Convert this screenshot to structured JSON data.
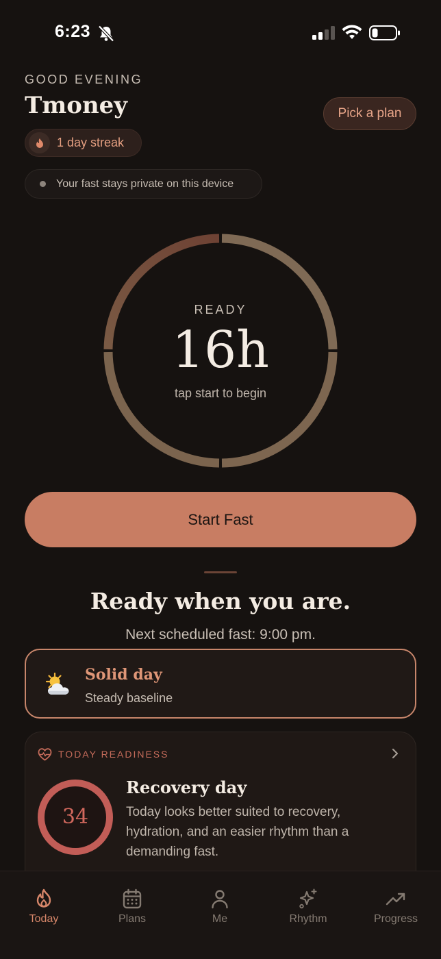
{
  "status_bar": {
    "time": "6:23",
    "icons": [
      "bell-slash-icon",
      "signal-icon",
      "wifi-icon",
      "battery-icon"
    ]
  },
  "header": {
    "greeting": "GOOD EVENING",
    "user_name": "Tmoney",
    "plan_button": "Pick a plan",
    "streak": "1 day streak",
    "privacy": "Your fast stays private on this device"
  },
  "timer": {
    "status": "READY",
    "duration": "16h",
    "hint": "tap start to begin"
  },
  "start_button": "Start Fast",
  "ready_section": {
    "heading": "Ready when you are.",
    "next_fast": "Next scheduled fast: 9:00 pm."
  },
  "day_card": {
    "icon": "sun-behind-cloud-icon",
    "title": "Solid day",
    "subtitle": "Steady baseline"
  },
  "readiness": {
    "label": "TODAY READINESS",
    "score": "34",
    "title": "Recovery day",
    "body": "Today looks better suited to recovery, hydration, and an easier rhythm than a demanding fast."
  },
  "tabs": [
    {
      "label": "Today",
      "icon": "flame-icon",
      "active": true
    },
    {
      "label": "Plans",
      "icon": "calendar-icon",
      "active": false
    },
    {
      "label": "Me",
      "icon": "person-icon",
      "active": false
    },
    {
      "label": "Rhythm",
      "icon": "sparkles-icon",
      "active": false
    },
    {
      "label": "Progress",
      "icon": "trend-up-icon",
      "active": false
    }
  ],
  "colors": {
    "background": "#161210",
    "accent": "#c87d63",
    "accent_text": "#df9677",
    "readiness_red": "#c46b5a"
  }
}
